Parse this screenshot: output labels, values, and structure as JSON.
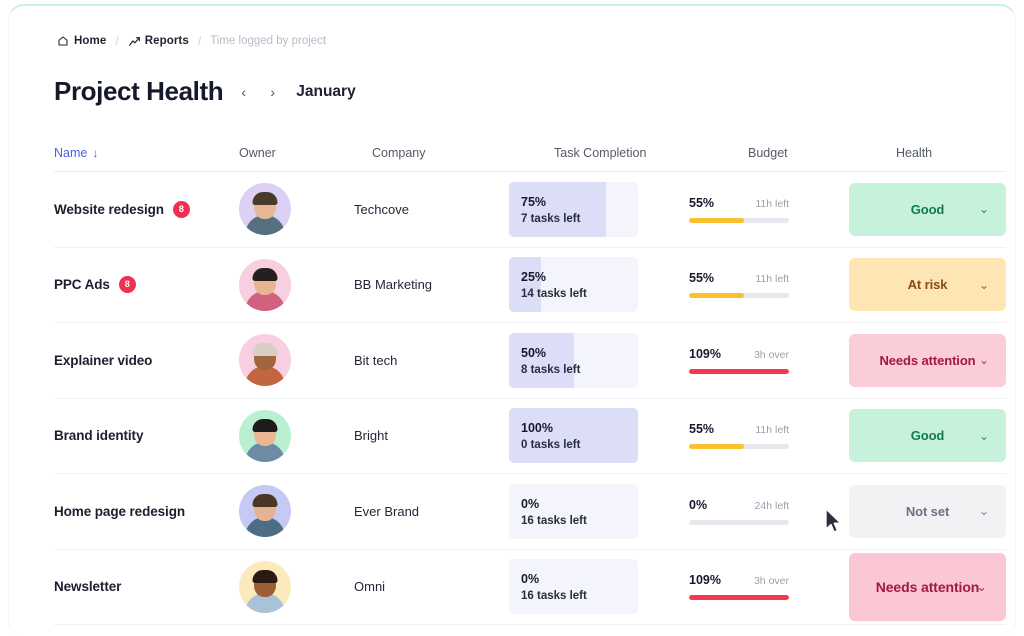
{
  "breadcrumb": {
    "home": "Home",
    "reports": "Reports",
    "current": "Time logged by project",
    "separator": "/",
    "home_icon": "home-icon",
    "reports_icon": "chart-line-icon"
  },
  "header": {
    "title": "Project Health",
    "prev_label": "‹",
    "next_label": "›",
    "month": "January"
  },
  "table": {
    "columns": [
      {
        "key": "name",
        "label": "Name",
        "sorted": true,
        "sort_arrow": "↓"
      },
      {
        "key": "owner",
        "label": "Owner",
        "sorted": false
      },
      {
        "key": "company",
        "label": "Company",
        "sorted": false
      },
      {
        "key": "task",
        "label": "Task Completion",
        "sorted": false
      },
      {
        "key": "budget",
        "label": "Budget",
        "sorted": false
      },
      {
        "key": "health",
        "label": "Health",
        "sorted": false
      }
    ],
    "rows": [
      {
        "name": "Website redesign",
        "badge": "8",
        "avatar": {
          "bg": "#dcd0f5",
          "skin": "#e8b894",
          "hair": "#4a3a2c",
          "shirt": "#56707f"
        },
        "company": "Techcove",
        "task_pct": "75%",
        "task_value": 75,
        "tasks_left": "7 tasks left",
        "budget_pct": "55%",
        "budget_value": 55,
        "budget_note": "11h left",
        "budget_color": "#fcc02e",
        "health": "Good",
        "health_bg": "#c6f2dc",
        "health_fg": "#127a4e",
        "chevron": "⌄"
      },
      {
        "name": "PPC Ads",
        "badge": "8",
        "avatar": {
          "bg": "#f7cfe0",
          "skin": "#e7b58f",
          "hair": "#23201f",
          "shirt": "#d2607f"
        },
        "company": "BB Marketing",
        "task_pct": "25%",
        "task_value": 25,
        "tasks_left": "14 tasks left",
        "budget_pct": "55%",
        "budget_value": 55,
        "budget_note": "11h left",
        "budget_color": "#fcc02e",
        "health": "At risk",
        "health_bg": "#fde6b4",
        "health_fg": "#8a4b14",
        "chevron": "⌄"
      },
      {
        "name": "Explainer video",
        "badge": "",
        "avatar": {
          "bg": "#f9cde2",
          "skin": "#a0653c",
          "hair": "#d8cfc2",
          "shirt": "#c2663f"
        },
        "company": "Bit tech",
        "task_pct": "50%",
        "task_value": 50,
        "tasks_left": "8 tasks left",
        "budget_pct": "109%",
        "budget_value": 100,
        "budget_note": "3h over",
        "budget_color": "#f5384e",
        "health": "Needs attention",
        "health_bg": "#fbcdd8",
        "health_fg": "#a3183f",
        "chevron": "⌄"
      },
      {
        "name": "Brand identity",
        "badge": "",
        "avatar": {
          "bg": "#b9f0d2",
          "skin": "#e9b893",
          "hair": "#1e1c1b",
          "shirt": "#6d8ba5"
        },
        "company": "Bright",
        "task_pct": "100%",
        "task_value": 100,
        "tasks_left": "0 tasks left",
        "budget_pct": "55%",
        "budget_value": 55,
        "budget_note": "11h left",
        "budget_color": "#fcc02e",
        "health": "Good",
        "health_bg": "#c6f2dc",
        "health_fg": "#127a4e",
        "chevron": "⌄"
      },
      {
        "name": "Home page redesign",
        "badge": "",
        "avatar": {
          "bg": "#c5caf5",
          "skin": "#e5b391",
          "hair": "#4b3724",
          "shirt": "#4d6d86"
        },
        "company": "Ever Brand",
        "task_pct": "0%",
        "task_value": 0,
        "tasks_left": "16 tasks left",
        "budget_pct": "0%",
        "budget_value": 0,
        "budget_note": "24h left",
        "budget_color": "#e6e8ee",
        "health": "Not set",
        "health_bg": "#f2f2f5",
        "health_fg": "#6d7280",
        "chevron": "⌄"
      },
      {
        "name": "Newsletter",
        "badge": "",
        "avatar": {
          "bg": "#fce9bc",
          "skin": "#9c5f37",
          "hair": "#2a1a12",
          "shirt": "#a8c2d8"
        },
        "company": "Omni",
        "task_pct": "0%",
        "task_value": 0,
        "tasks_left": "16 tasks left",
        "budget_pct": "109%",
        "budget_value": 100,
        "budget_note": "3h over",
        "budget_color": "#f5384e",
        "health": "Needs attention",
        "health_bg": "#fbc7d4",
        "health_fg": "#a3183f",
        "chevron": "⌄",
        "emphasis": true
      }
    ]
  },
  "cursor": {
    "icon": "mouse-pointer-icon"
  }
}
